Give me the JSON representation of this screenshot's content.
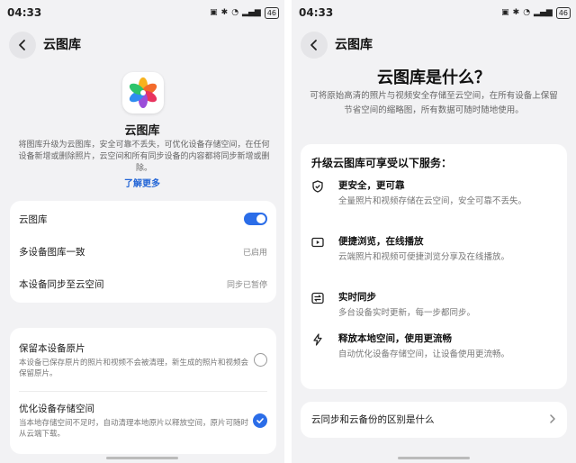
{
  "status": {
    "time": "04:33",
    "battery": "46"
  },
  "left": {
    "nav_title": "云图库",
    "app_name": "云图库",
    "description": "将图库升级为云图库，安全可靠不丢失，可优化设备存储空间，在任何设备新增或删除照片，云空间和所有同步设备的内容都将同步新增或删除。",
    "learn_more": "了解更多",
    "settings": [
      {
        "label": "云图库",
        "value": ""
      },
      {
        "label": "多设备图库一致",
        "value": "已启用"
      },
      {
        "label": "本设备同步至云空间",
        "value": "同步已暂停"
      }
    ],
    "options": [
      {
        "title": "保留本设备原片",
        "desc": "本设备已保存原片的照片和视频不会被清理，新生成的照片和视频会保留原片。",
        "selected": false
      },
      {
        "title": "优化设备存储空间",
        "desc": "当本地存储空间不足时，自动清理本地原片以释放空间，原片可随时从云端下载。",
        "selected": true
      }
    ]
  },
  "right": {
    "nav_title": "云图库",
    "title": "云图库是什么？",
    "description": "可将原始高清的照片与视频安全存储至云空间，在所有设备上保留节省空间的缩略图，所有数据可随时随地使用。",
    "services_title": "升级云图库可享受以下服务：",
    "features": [
      {
        "icon": "shield-icon",
        "title": "更安全，更可靠",
        "desc": "全量照片和视频存储在云空间，安全可靠不丢失。"
      },
      {
        "icon": "play-icon",
        "title": "便捷浏览，在线播放",
        "desc": "云端照片和视频可便捷浏览分享及在线播放。"
      },
      {
        "icon": "sync-icon",
        "title": "实时同步",
        "desc": "多台设备实时更新，每一步都同步。"
      },
      {
        "icon": "bolt-icon",
        "title": "释放本地空间，使用更流畅",
        "desc": "自动优化设备存储空间，让设备使用更流畅。"
      }
    ],
    "faq_label": "云同步和云备份的区别是什么"
  }
}
